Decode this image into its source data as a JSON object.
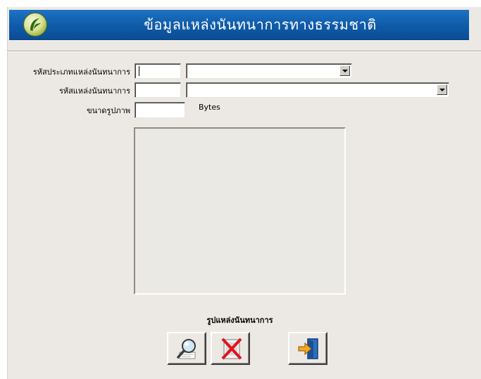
{
  "header": {
    "title": "ข้อมูลแหล่งนันทนาการทางธรรมชาติ",
    "logo_icon": "leaf-logo-icon"
  },
  "form": {
    "type_code": {
      "label": "รหัสประเภทแหล่งนันทนาการ",
      "value": "",
      "selected": ""
    },
    "place_code": {
      "label": "รหัสแหล่งนันทนาการ",
      "value": "",
      "selected": ""
    },
    "image_size": {
      "label": "ขนาดรูปภาพ",
      "value": "",
      "unit": "Bytes"
    }
  },
  "image_panel": {
    "caption": "รูปแหล่งนันทนาการ"
  },
  "buttons": {
    "browse_icon": "magnifier-icon",
    "delete_icon": "delete-x-icon",
    "exit_icon": "exit-door-icon"
  },
  "colors": {
    "header_blue": "#1265b5",
    "panel_bg": "#ece9e4",
    "delete_red": "#e0141e"
  }
}
